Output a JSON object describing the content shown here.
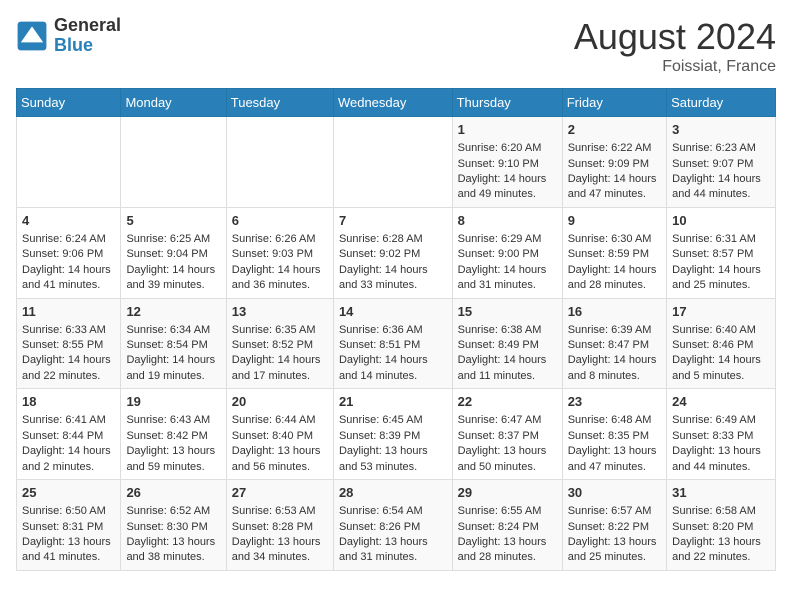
{
  "header": {
    "logo_general": "General",
    "logo_blue": "Blue",
    "month_title": "August 2024",
    "location": "Foissiat, France"
  },
  "days_of_week": [
    "Sunday",
    "Monday",
    "Tuesday",
    "Wednesday",
    "Thursday",
    "Friday",
    "Saturday"
  ],
  "weeks": [
    [
      {
        "day": "",
        "info": ""
      },
      {
        "day": "",
        "info": ""
      },
      {
        "day": "",
        "info": ""
      },
      {
        "day": "",
        "info": ""
      },
      {
        "day": "1",
        "info": "Sunrise: 6:20 AM\nSunset: 9:10 PM\nDaylight: 14 hours and 49 minutes."
      },
      {
        "day": "2",
        "info": "Sunrise: 6:22 AM\nSunset: 9:09 PM\nDaylight: 14 hours and 47 minutes."
      },
      {
        "day": "3",
        "info": "Sunrise: 6:23 AM\nSunset: 9:07 PM\nDaylight: 14 hours and 44 minutes."
      }
    ],
    [
      {
        "day": "4",
        "info": "Sunrise: 6:24 AM\nSunset: 9:06 PM\nDaylight: 14 hours and 41 minutes."
      },
      {
        "day": "5",
        "info": "Sunrise: 6:25 AM\nSunset: 9:04 PM\nDaylight: 14 hours and 39 minutes."
      },
      {
        "day": "6",
        "info": "Sunrise: 6:26 AM\nSunset: 9:03 PM\nDaylight: 14 hours and 36 minutes."
      },
      {
        "day": "7",
        "info": "Sunrise: 6:28 AM\nSunset: 9:02 PM\nDaylight: 14 hours and 33 minutes."
      },
      {
        "day": "8",
        "info": "Sunrise: 6:29 AM\nSunset: 9:00 PM\nDaylight: 14 hours and 31 minutes."
      },
      {
        "day": "9",
        "info": "Sunrise: 6:30 AM\nSunset: 8:59 PM\nDaylight: 14 hours and 28 minutes."
      },
      {
        "day": "10",
        "info": "Sunrise: 6:31 AM\nSunset: 8:57 PM\nDaylight: 14 hours and 25 minutes."
      }
    ],
    [
      {
        "day": "11",
        "info": "Sunrise: 6:33 AM\nSunset: 8:55 PM\nDaylight: 14 hours and 22 minutes."
      },
      {
        "day": "12",
        "info": "Sunrise: 6:34 AM\nSunset: 8:54 PM\nDaylight: 14 hours and 19 minutes."
      },
      {
        "day": "13",
        "info": "Sunrise: 6:35 AM\nSunset: 8:52 PM\nDaylight: 14 hours and 17 minutes."
      },
      {
        "day": "14",
        "info": "Sunrise: 6:36 AM\nSunset: 8:51 PM\nDaylight: 14 hours and 14 minutes."
      },
      {
        "day": "15",
        "info": "Sunrise: 6:38 AM\nSunset: 8:49 PM\nDaylight: 14 hours and 11 minutes."
      },
      {
        "day": "16",
        "info": "Sunrise: 6:39 AM\nSunset: 8:47 PM\nDaylight: 14 hours and 8 minutes."
      },
      {
        "day": "17",
        "info": "Sunrise: 6:40 AM\nSunset: 8:46 PM\nDaylight: 14 hours and 5 minutes."
      }
    ],
    [
      {
        "day": "18",
        "info": "Sunrise: 6:41 AM\nSunset: 8:44 PM\nDaylight: 14 hours and 2 minutes."
      },
      {
        "day": "19",
        "info": "Sunrise: 6:43 AM\nSunset: 8:42 PM\nDaylight: 13 hours and 59 minutes."
      },
      {
        "day": "20",
        "info": "Sunrise: 6:44 AM\nSunset: 8:40 PM\nDaylight: 13 hours and 56 minutes."
      },
      {
        "day": "21",
        "info": "Sunrise: 6:45 AM\nSunset: 8:39 PM\nDaylight: 13 hours and 53 minutes."
      },
      {
        "day": "22",
        "info": "Sunrise: 6:47 AM\nSunset: 8:37 PM\nDaylight: 13 hours and 50 minutes."
      },
      {
        "day": "23",
        "info": "Sunrise: 6:48 AM\nSunset: 8:35 PM\nDaylight: 13 hours and 47 minutes."
      },
      {
        "day": "24",
        "info": "Sunrise: 6:49 AM\nSunset: 8:33 PM\nDaylight: 13 hours and 44 minutes."
      }
    ],
    [
      {
        "day": "25",
        "info": "Sunrise: 6:50 AM\nSunset: 8:31 PM\nDaylight: 13 hours and 41 minutes."
      },
      {
        "day": "26",
        "info": "Sunrise: 6:52 AM\nSunset: 8:30 PM\nDaylight: 13 hours and 38 minutes."
      },
      {
        "day": "27",
        "info": "Sunrise: 6:53 AM\nSunset: 8:28 PM\nDaylight: 13 hours and 34 minutes."
      },
      {
        "day": "28",
        "info": "Sunrise: 6:54 AM\nSunset: 8:26 PM\nDaylight: 13 hours and 31 minutes."
      },
      {
        "day": "29",
        "info": "Sunrise: 6:55 AM\nSunset: 8:24 PM\nDaylight: 13 hours and 28 minutes."
      },
      {
        "day": "30",
        "info": "Sunrise: 6:57 AM\nSunset: 8:22 PM\nDaylight: 13 hours and 25 minutes."
      },
      {
        "day": "31",
        "info": "Sunrise: 6:58 AM\nSunset: 8:20 PM\nDaylight: 13 hours and 22 minutes."
      }
    ]
  ]
}
